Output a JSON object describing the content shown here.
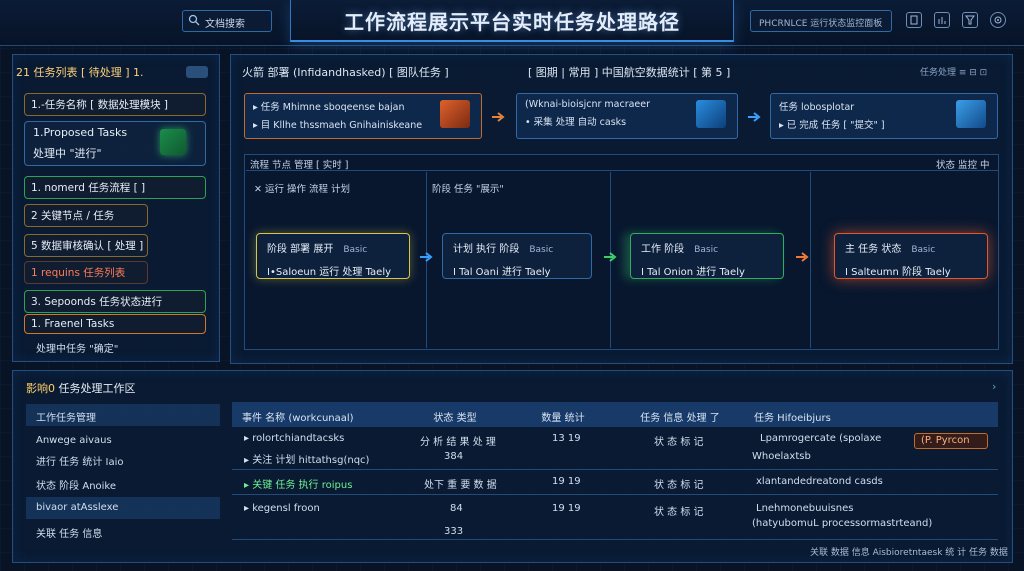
{
  "header": {
    "title": "工作流程展示平台实时任务处理路径",
    "search_label": "文档搜索",
    "brand_text": "PHCRNLCE 运行状态监控面板",
    "icons": [
      "tablet-icon",
      "chart-icon",
      "filter-icon",
      "settings-icon"
    ]
  },
  "left_panel": {
    "title": "21 任务列表 [ 待处理 ] 1.",
    "tasks": [
      {
        "label": "1.-任务名称 [ 数据处理模块 ]",
        "style": "gold"
      },
      {
        "label": "1.Proposed Tasks",
        "line2": "处理中 \"进行\"",
        "style": "blue"
      },
      {
        "label": "1. nomerd 任务流程 [ ]",
        "style": "green"
      },
      {
        "label": "2 关键节点 / 任务",
        "style": "gold"
      },
      {
        "label": "5 数据审核确认 [ 处理 ]",
        "style": "gold"
      },
      {
        "label": "1 requins 任务列表",
        "style": "red"
      },
      {
        "label": "3. Sepoonds 任务状态进行",
        "style": "green"
      },
      {
        "label": "1. Fraenel Tasks",
        "style": "orange"
      },
      {
        "label": "处理中任务 \"确定\"",
        "style": "plain"
      }
    ]
  },
  "main_panel": {
    "title_left": "火箭 部署 (Infidandhasked) [ 图队任务 ]",
    "title_right": "[ 图期 | 常用 ] 中国航空数据统计 [ 第 5 ]",
    "header_right": "任务处理 ≡ ⊟ ⊡",
    "cards": [
      {
        "line1": "▸ 任务 Mhimne sboqeense bajan",
        "line2": "▸ 目 Kllhe thssmaeh Gnihainiskeane"
      },
      {
        "line1": "(Wknai-bioisjcnr macraeer",
        "line2": "• 采集 处理 自动 casks"
      },
      {
        "line1": "任务 lobosplotar",
        "line2": "▸ 已 完成 任务 [ \"提交\" ]"
      }
    ],
    "flow_header": "流程 节点 管理 [ 实时 ]",
    "flow_header_right": "状态 监控 中",
    "flow_sub_left": "✕ 运行 操作 流程 计划",
    "flow_sub_right": "阶段 任务 \"展示\"",
    "stages": [
      {
        "title": "阶段 部署 展开",
        "tag": "Basic",
        "line2": "I•Saloeun 运行 处理 Taely"
      },
      {
        "title": "计划 执行 阶段",
        "tag": "Basic",
        "line2": "I Tal Oani 进行 Taely"
      },
      {
        "title": "工作 阶段",
        "tag": "Basic",
        "line2": "I Tal Onion 进行 Taely"
      },
      {
        "title": "主 任务 状态",
        "tag": "Basic",
        "line2": "I Salteumn 阶段 Taely"
      }
    ]
  },
  "bottom_panel": {
    "title_prefix": "影响0",
    "title": "任务处理工作区",
    "left_rows": [
      {
        "label": "工作任务管理",
        "shade": true
      },
      {
        "label": "Anwege aivaus",
        "shade": false
      },
      {
        "label": "进行 任务 统计 Iaio",
        "shade": false
      },
      {
        "label": "状态 阶段 Anoike",
        "shade": false
      },
      {
        "label": "bivaor atAsslexe",
        "shade": true
      },
      {
        "label": "关联 任务 信息",
        "shade": false
      }
    ],
    "columns": [
      "事件 名称 (workcunaal)",
      "状态 类型",
      "数量 统计",
      "任务 信息 处理 了",
      "任务 Hifoeibjurs"
    ],
    "rows": [
      {
        "name": "▸ rolortchiandtacsks",
        "name2": "▸ 关注 计划 hittathsg(nqc)",
        "type": "分 析 结 果 处 理",
        "type2": "384",
        "count": "13 19",
        "info": "状 态 标 记",
        "detail": "Lpamrogercate (spolaxe",
        "detail2": "Whoelaxtsb",
        "pill": "(P. Pyrcon"
      },
      {
        "name": "▸ 关键 任务 执行 roipus",
        "type": "处下 重 要 数 据",
        "count": "19 19",
        "info": "状 态 标 记",
        "detail": "xlantandedreatond casds"
      },
      {
        "name": "▸ kegensl froon",
        "type": "84",
        "type2": "333",
        "count": "19 19",
        "info": "状 态 标 记",
        "detail": "Lnehmonebuuisnes",
        "detail2": "(hatyubomuL processormastrteand)"
      }
    ],
    "footer": "关联 数据 信息 Aisbioretntaesk 统 计 任务 数据"
  },
  "colors": {
    "accent": "#3a8ee0",
    "warning": "#d0782a",
    "success": "#2fae5f",
    "danger": "#e2572e"
  }
}
